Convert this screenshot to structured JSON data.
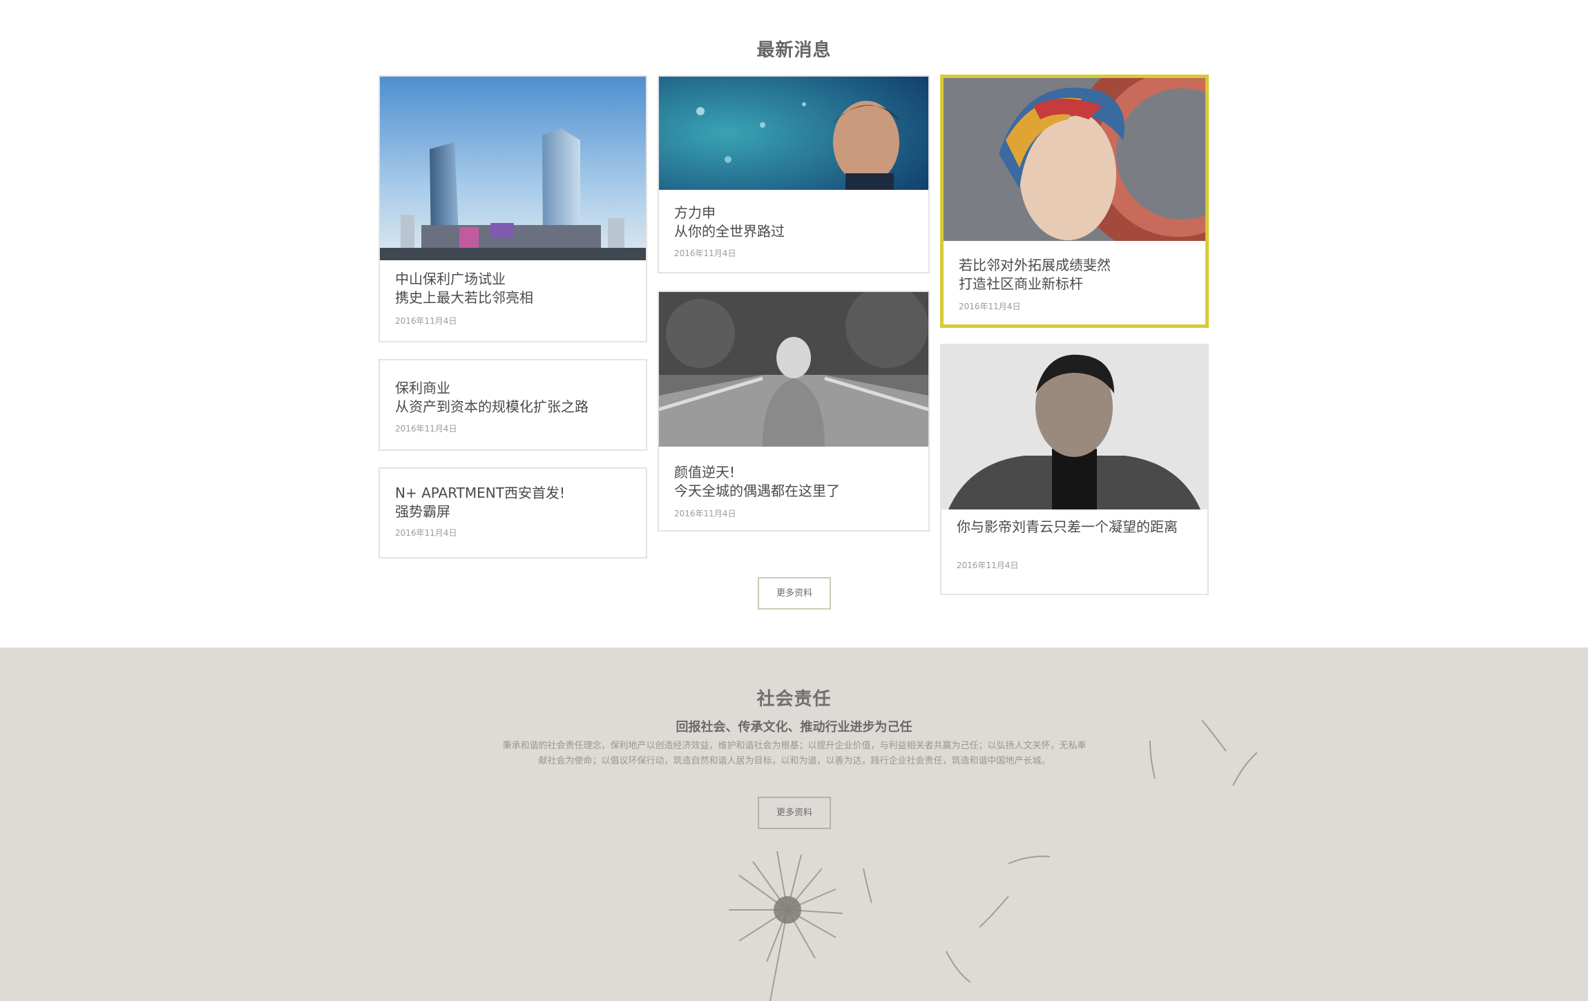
{
  "news": {
    "title": "最新消息",
    "more_label": "更多资料",
    "cards": [
      {
        "title_line1": "中山保利广场试业",
        "title_line2": "携史上最大若比邻亮相",
        "date": "2016年11月4日",
        "image": "city-towers-photo"
      },
      {
        "title_line1": "方力申",
        "title_line2": "从你的全世界路过",
        "date": "2016年11月4日",
        "image": "man-portrait-photo"
      },
      {
        "title_line1": "若比邻对外拓展成绩斐然",
        "title_line2": "打造社区商业新标杆",
        "date": "2016年11月4日",
        "image": "woman-headscarf-photo"
      },
      {
        "title_line1": "保利商业",
        "title_line2": "从资产到资本的规模化扩张之路",
        "date": "2016年11月4日"
      },
      {
        "title_line1": "颜值逆天!",
        "title_line2": "今天全城的偶遇都在这里了",
        "date": "2016年11月4日",
        "image": "woman-bridge-photo"
      },
      {
        "title_line1": "你与影帝刘青云只差一个凝望的距离",
        "title_line2": "",
        "date": "2016年11月4日",
        "image": "actor-portrait-photo"
      },
      {
        "title_line1": "N+ APARTMENT西安首发!",
        "title_line2": "强势霸屏",
        "date": "2016年11月4日"
      }
    ]
  },
  "csr": {
    "title": "社会责任",
    "subtitle": "回报社会、传承文化、推动行业进步为己任",
    "desc_line1": "秉承和谐的社会责任理念，保利地产以创造经济效益，维护和谐社会为根基；以提升企业价值，与利益相关者共赢为己任；以弘扬人文关怀，无私奉",
    "desc_line2": "献社会为使命；以倡议环保行动，筑造自然和谐人居为目标，以和为道，以善为达，践行企业社会责任，筑造和谐中国地产长城。",
    "more_label": "更多资料",
    "decoration": "dandelion-illustration"
  },
  "colors": {
    "active_border": "#d6cb36",
    "csr_background": "#dedbd6",
    "button_border": "#cfc8b5"
  }
}
